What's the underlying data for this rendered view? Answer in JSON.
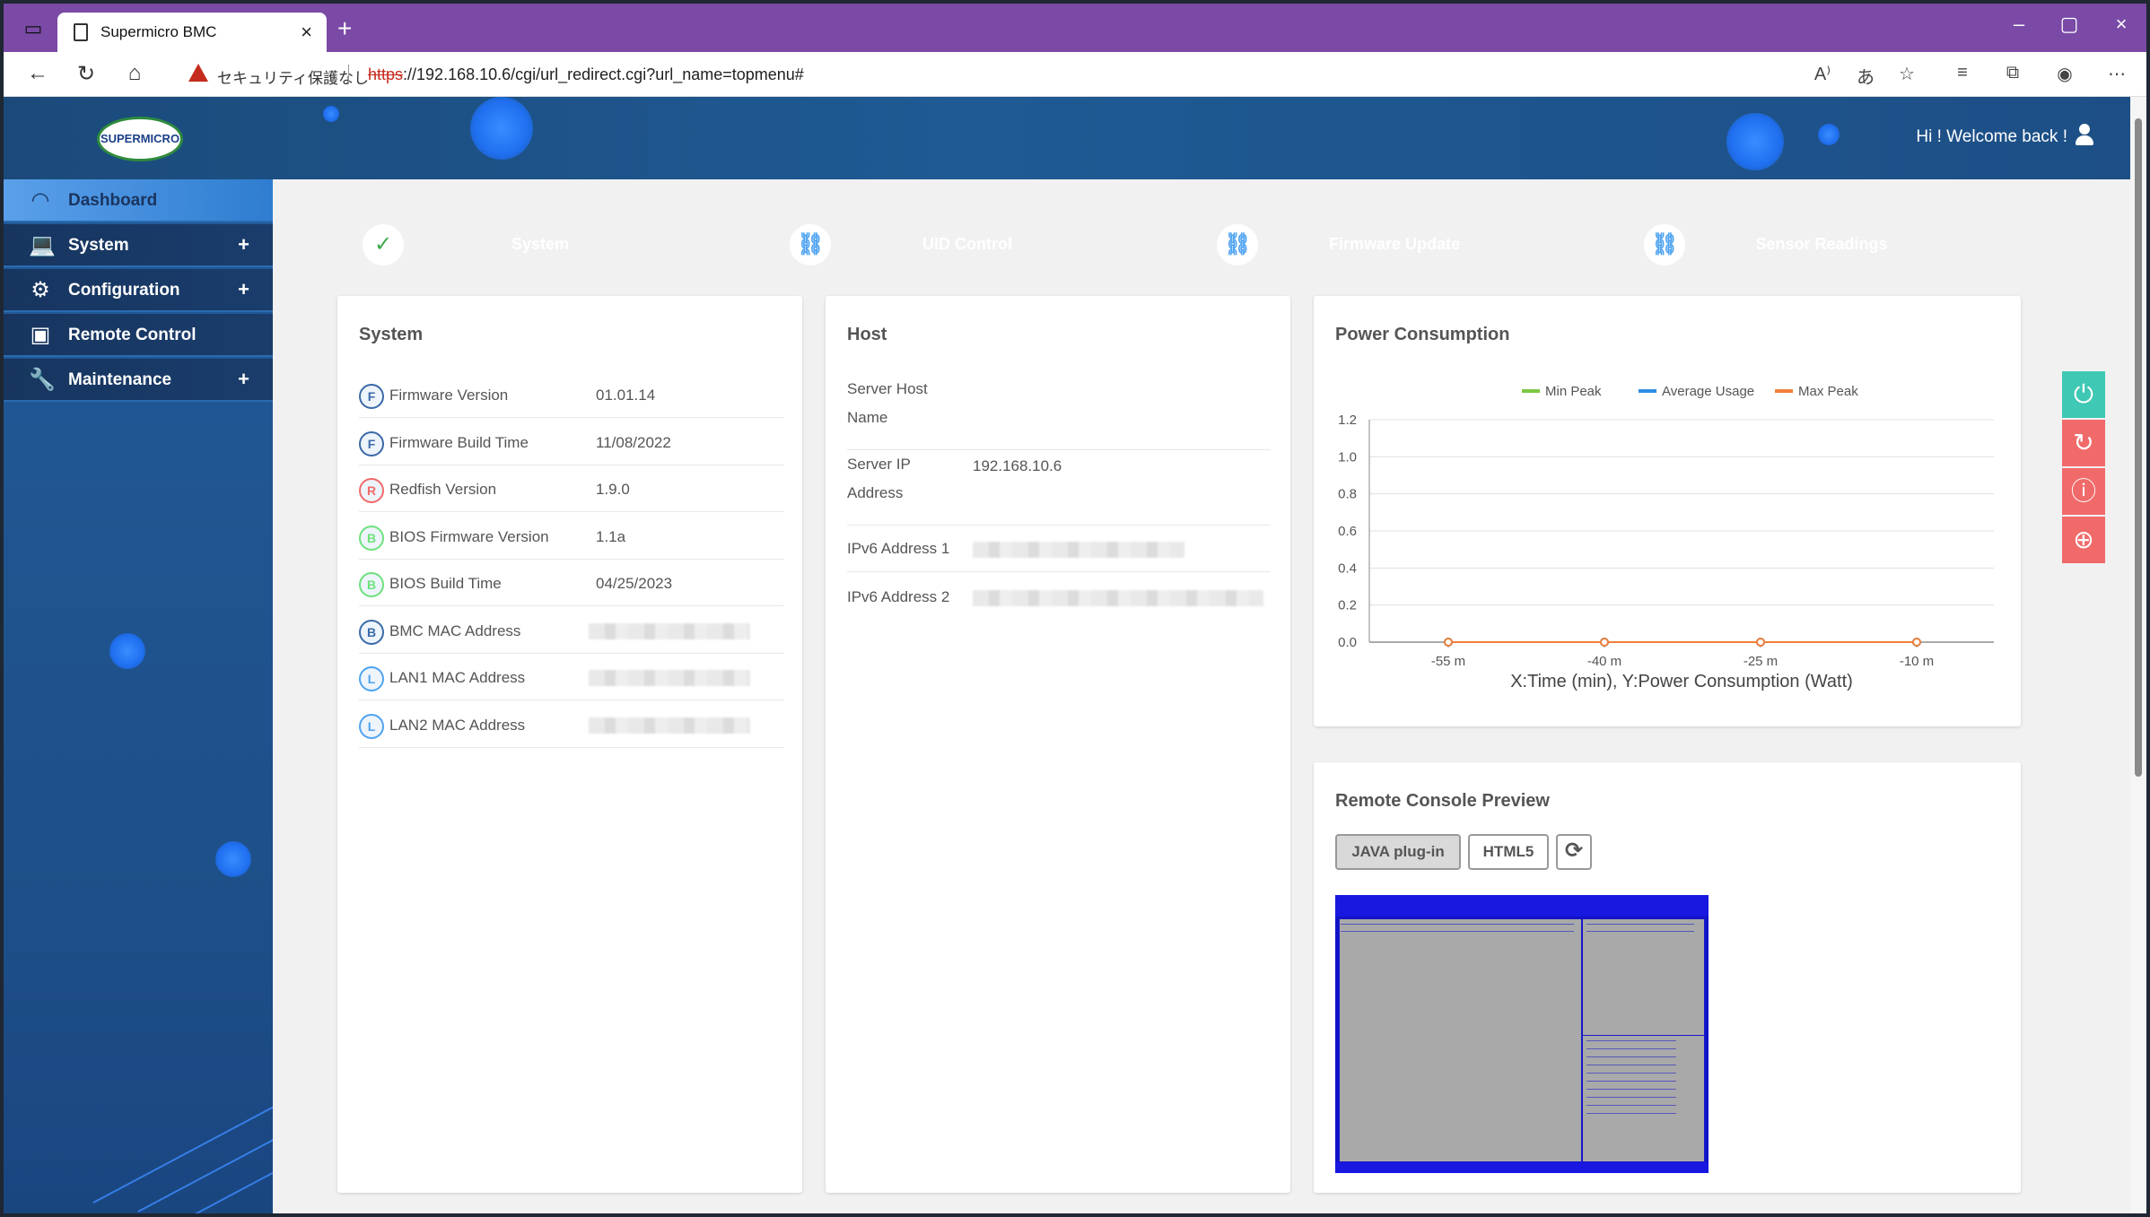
{
  "browser": {
    "tab_title": "Supermicro BMC",
    "security_warning": "セキュリティ保護なし",
    "url_scheme": "https",
    "url_rest": "://192.168.10.6/cgi/url_redirect.cgi?url_name=topmenu#"
  },
  "header": {
    "logo_text": "SUPERMICRO",
    "welcome": "Hi ! Welcome back !"
  },
  "sidebar": {
    "items": [
      {
        "label": "Dashboard",
        "icon": "gauge-icon",
        "expandable": false
      },
      {
        "label": "System",
        "icon": "laptop-icon",
        "expandable": true
      },
      {
        "label": "Configuration",
        "icon": "gear-icon",
        "expandable": true
      },
      {
        "label": "Remote Control",
        "icon": "console-icon",
        "expandable": false
      },
      {
        "label": "Maintenance",
        "icon": "wrench-icon",
        "expandable": true
      }
    ],
    "expand_symbol": "+"
  },
  "quick_buttons": [
    {
      "label": "System",
      "color": "#6ee17c"
    },
    {
      "label": "UID Control",
      "color": "#4ea3f0"
    },
    {
      "label": "Firmware Update",
      "color": "#4ea3f0"
    },
    {
      "label": "Sensor Readings",
      "color": "#4ea3f0"
    }
  ],
  "system_card": {
    "title": "System",
    "rows": [
      {
        "badge": "F",
        "label": "Firmware Version",
        "value": "01.01.14"
      },
      {
        "badge": "F",
        "label": "Firmware Build Time",
        "value": "11/08/2022"
      },
      {
        "badge": "R",
        "label": "Redfish Version",
        "value": "1.9.0"
      },
      {
        "badge": "B",
        "label": "BIOS Firmware Version",
        "value": "1.1a"
      },
      {
        "badge": "B",
        "label": "BIOS Build Time",
        "value": "04/25/2023"
      },
      {
        "badge": "B",
        "label": "BMC MAC Address",
        "value": ""
      },
      {
        "badge": "L",
        "label": "LAN1 MAC Address",
        "value": ""
      },
      {
        "badge": "L",
        "label": "LAN2 MAC Address",
        "value": ""
      }
    ]
  },
  "host_card": {
    "title": "Host",
    "rows": [
      {
        "label_line1": "Server Host",
        "label_line2": "Name",
        "value": ""
      },
      {
        "label_line1": "Server IP",
        "label_line2": "Address",
        "value": "192.168.10.6"
      },
      {
        "label_line1": "IPv6 Address 1",
        "label_line2": "",
        "value": ""
      },
      {
        "label_line1": "IPv6 Address 2",
        "label_line2": "",
        "value": ""
      }
    ]
  },
  "power_card": {
    "title": "Power Consumption"
  },
  "chart_data": {
    "type": "line",
    "title": "",
    "caption": "X:Time (min), Y:Power Consumption (Watt)",
    "categories": [
      "-55 m",
      "-40 m",
      "-25 m",
      "-10 m"
    ],
    "series": [
      {
        "name": "Min Peak",
        "color": "#7ac943",
        "values": [
          0,
          0,
          0,
          0
        ]
      },
      {
        "name": "Average Usage",
        "color": "#2f8de4",
        "values": [
          0,
          0,
          0,
          0
        ]
      },
      {
        "name": "Max Peak",
        "color": "#f07f3c",
        "values": [
          0,
          0,
          0,
          0
        ]
      }
    ],
    "ylim": [
      0,
      1.2
    ],
    "yticks": [
      "0.0",
      "0.2",
      "0.4",
      "0.6",
      "0.8",
      "1.0",
      "1.2"
    ],
    "legend": "top",
    "grid": true
  },
  "remote_console": {
    "title": "Remote Console Preview",
    "java_label": "JAVA plug-in",
    "html5_label": "HTML5"
  },
  "floating_actions": [
    {
      "icon": "power-icon",
      "color": "#3fc8b4"
    },
    {
      "icon": "refresh-icon",
      "color": "#f06a6a"
    },
    {
      "icon": "info-icon",
      "color": "#f06a6a"
    },
    {
      "icon": "globe-icon",
      "color": "#f06a6a"
    }
  ]
}
